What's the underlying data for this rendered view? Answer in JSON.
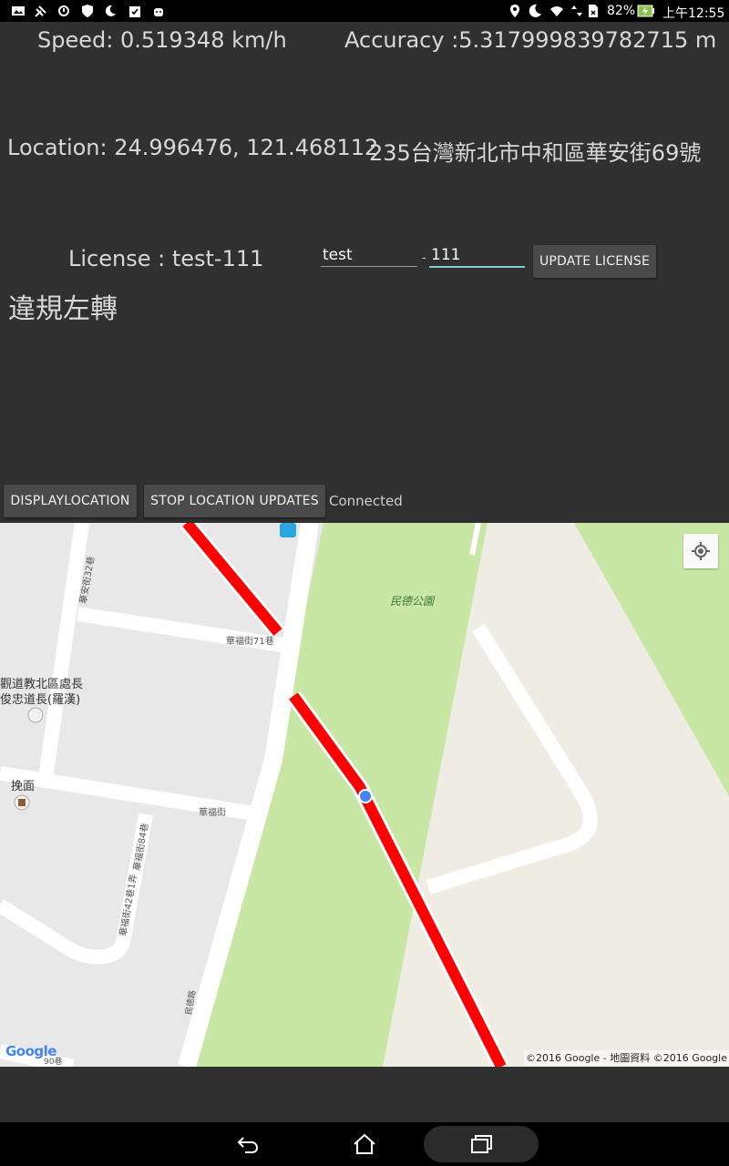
{
  "status_bar": {
    "battery_percent": "82%",
    "time": "上午12:55"
  },
  "info": {
    "speed": "Speed: 0.519348 km/h",
    "accuracy": "Accuracy :5.317999839782715 m",
    "location": "Location: 24.996476, 121.468112",
    "address": "235台灣新北市中和區華安街69號",
    "license": "License : test-111",
    "violation": "違規左轉"
  },
  "license_form": {
    "prefix_value": "test",
    "separator": "-",
    "number_value": "111",
    "update_button": "UPDATE LICENSE"
  },
  "controls": {
    "display_location_button": "DISPLAYLOCATION",
    "stop_updates_button": "STOP LOCATION UPDATES",
    "connection_status": "Connected"
  },
  "map": {
    "labels": {
      "park": "民德公園",
      "lane_71": "華福街71巷",
      "lane_32": "華安街32巷",
      "temple_line1": "觀道教北區處長",
      "temple_line2": "俊忠道長(羅漢)",
      "pasta": "挽面",
      "huafu_st": "華福街",
      "lane_84": "華福街84巷",
      "lane_42": "華福街42巷1弄",
      "minde_rd": "民德路",
      "lane_90": "90巷"
    },
    "copyright": "©2016 Google - 地圖資料 ©2016 Google",
    "logo": "Google"
  },
  "colors": {
    "background": "#303030",
    "route": "#ff0000",
    "park": "#c8e6a4",
    "accent_underline": "#7fc9cc",
    "location_dot": "#4285f4"
  }
}
